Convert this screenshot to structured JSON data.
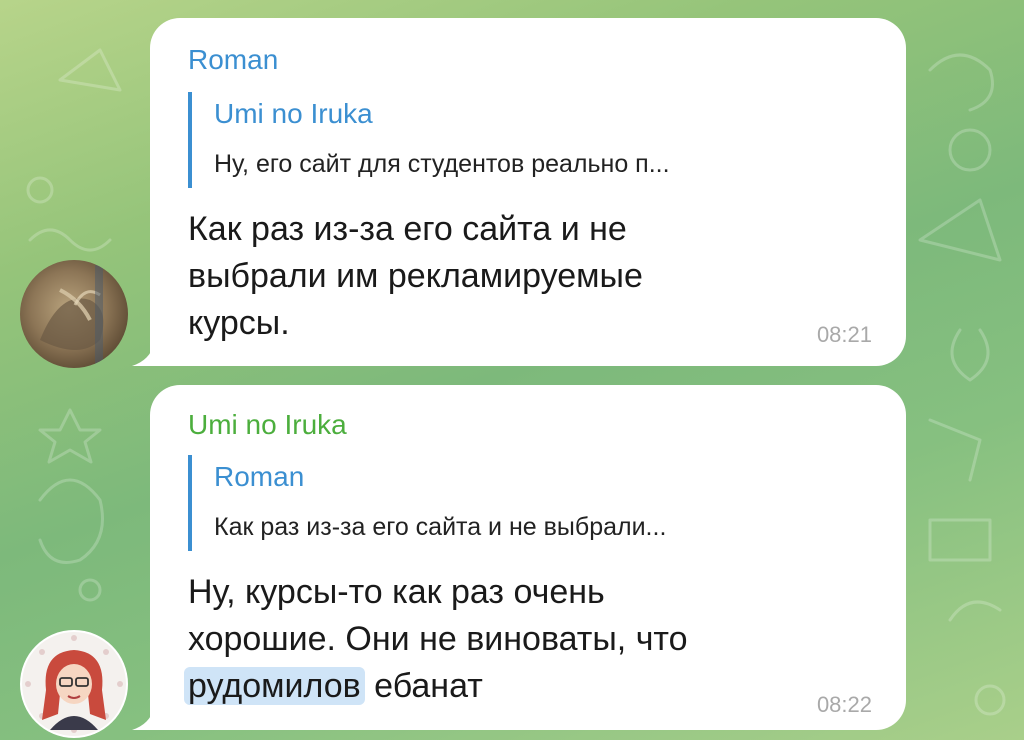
{
  "chat": {
    "messages": [
      {
        "sender": "Roman",
        "reply": {
          "name": "Umi no Iruka",
          "text": "Ну, его сайт для студентов реально п..."
        },
        "text_lines": [
          "Как раз из-за его сайта и не",
          "выбрали им рекламируемые",
          "курсы."
        ],
        "time": "08:21"
      },
      {
        "sender": "Umi no Iruka",
        "reply": {
          "name": "Roman",
          "text": "Как раз из-за его сайта и не выбрали..."
        },
        "text_lines": [
          "Ну, курсы-то как раз очень",
          "хорошие. Они не виноваты, что"
        ],
        "text_highlight": "рудомилов",
        "text_tail": " ебанат",
        "time": "08:22"
      }
    ]
  },
  "colors": {
    "sender_roman": "#3b8fd1",
    "sender_umi": "#4cae3d",
    "bubble": "#ffffff",
    "highlight": "#cfe4f7"
  },
  "icons": [
    "avatar-roman",
    "avatar-umi"
  ]
}
